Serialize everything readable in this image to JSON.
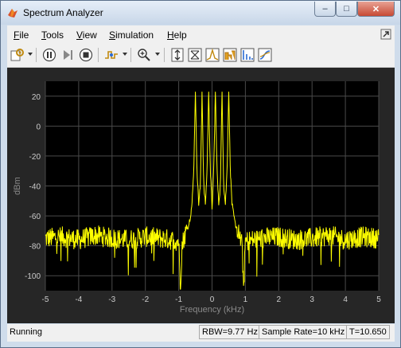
{
  "window": {
    "title": "Spectrum Analyzer",
    "minimize_glyph": "–",
    "maximize_glyph": "□",
    "close_glyph": "✕"
  },
  "menu": {
    "items": [
      {
        "key": "F",
        "rest": "ile"
      },
      {
        "key": "T",
        "rest": "ools"
      },
      {
        "key": "V",
        "rest": "iew"
      },
      {
        "key": "S",
        "rest": "imulation"
      },
      {
        "key": "H",
        "rest": "elp"
      }
    ]
  },
  "toolbar": {
    "icons": [
      "settings-icon",
      "pause-icon",
      "step-forward-icon",
      "stop-icon",
      "triggers-icon",
      "zoom-in-icon",
      "autoscale-icon",
      "cursor-measurements-icon",
      "channel-measurements-icon",
      "distortion-measurements-icon",
      "cdf-measurements-icon"
    ]
  },
  "status": {
    "state": "Running",
    "rbw": "RBW=9.77 Hz",
    "sample_rate": "Sample Rate=10 kHz",
    "time": "T=10.650"
  },
  "colors": {
    "plot_bg": "#262626",
    "axes_bg": "#000000",
    "trace": "#ffff00",
    "grid": "#4a4a4a"
  },
  "chart_data": {
    "type": "line",
    "xlabel": "Frequency (kHz)",
    "ylabel": "dBm",
    "xlim": [
      -5,
      5
    ],
    "ylim": [
      -110,
      30
    ],
    "xticks": [
      -5,
      -4,
      -3,
      -2,
      -1,
      0,
      1,
      2,
      3,
      4,
      5
    ],
    "yticks": [
      20,
      0,
      -20,
      -40,
      -60,
      -80,
      -100
    ],
    "xticklabels": [
      "-5",
      "-4",
      "-3",
      "-2",
      "-1",
      "0",
      "1",
      "2",
      "3",
      "4",
      "5"
    ],
    "yticklabels": [
      "20",
      "0",
      "-20",
      "-40",
      "-60",
      "-80",
      "-100"
    ],
    "grid": true,
    "noise_floor_dbm": -75,
    "series": [
      {
        "x": [
          -5,
          -4.5,
          -4,
          -3.5,
          -3,
          -2.5,
          -2,
          -1.5,
          -1,
          -0.95,
          -0.9,
          -0.85,
          -0.8,
          -0.75,
          -0.7,
          -0.65,
          -0.6,
          -0.55,
          -0.5,
          -0.45,
          -0.4,
          -0.35,
          -0.3,
          -0.25,
          -0.2,
          -0.15,
          -0.1,
          -0.05,
          0,
          0.05,
          0.1,
          0.15,
          0.2,
          0.25,
          0.3,
          0.35,
          0.4,
          0.45,
          0.5,
          0.55,
          0.6,
          0.65,
          0.7,
          0.75,
          0.8,
          0.85,
          0.9,
          0.95,
          1,
          1.5,
          2,
          2.5,
          3,
          3.5,
          4,
          4.5,
          5
        ],
        "y": [
          -75,
          -74,
          -76,
          -73,
          -75,
          -76,
          -74,
          -75,
          -77,
          -108,
          -80,
          -75,
          -72,
          -68,
          -66,
          -60,
          -52,
          -30,
          23,
          -30,
          -52,
          -40,
          23,
          -40,
          -52,
          -30,
          23,
          -30,
          -55,
          -30,
          23,
          -30,
          -52,
          -40,
          23,
          -40,
          -52,
          -30,
          23,
          -30,
          -52,
          -60,
          -66,
          -68,
          -72,
          -75,
          -80,
          -108,
          -77,
          -75,
          -74,
          -76,
          -75,
          -73,
          -76,
          -74,
          -75
        ]
      }
    ]
  }
}
